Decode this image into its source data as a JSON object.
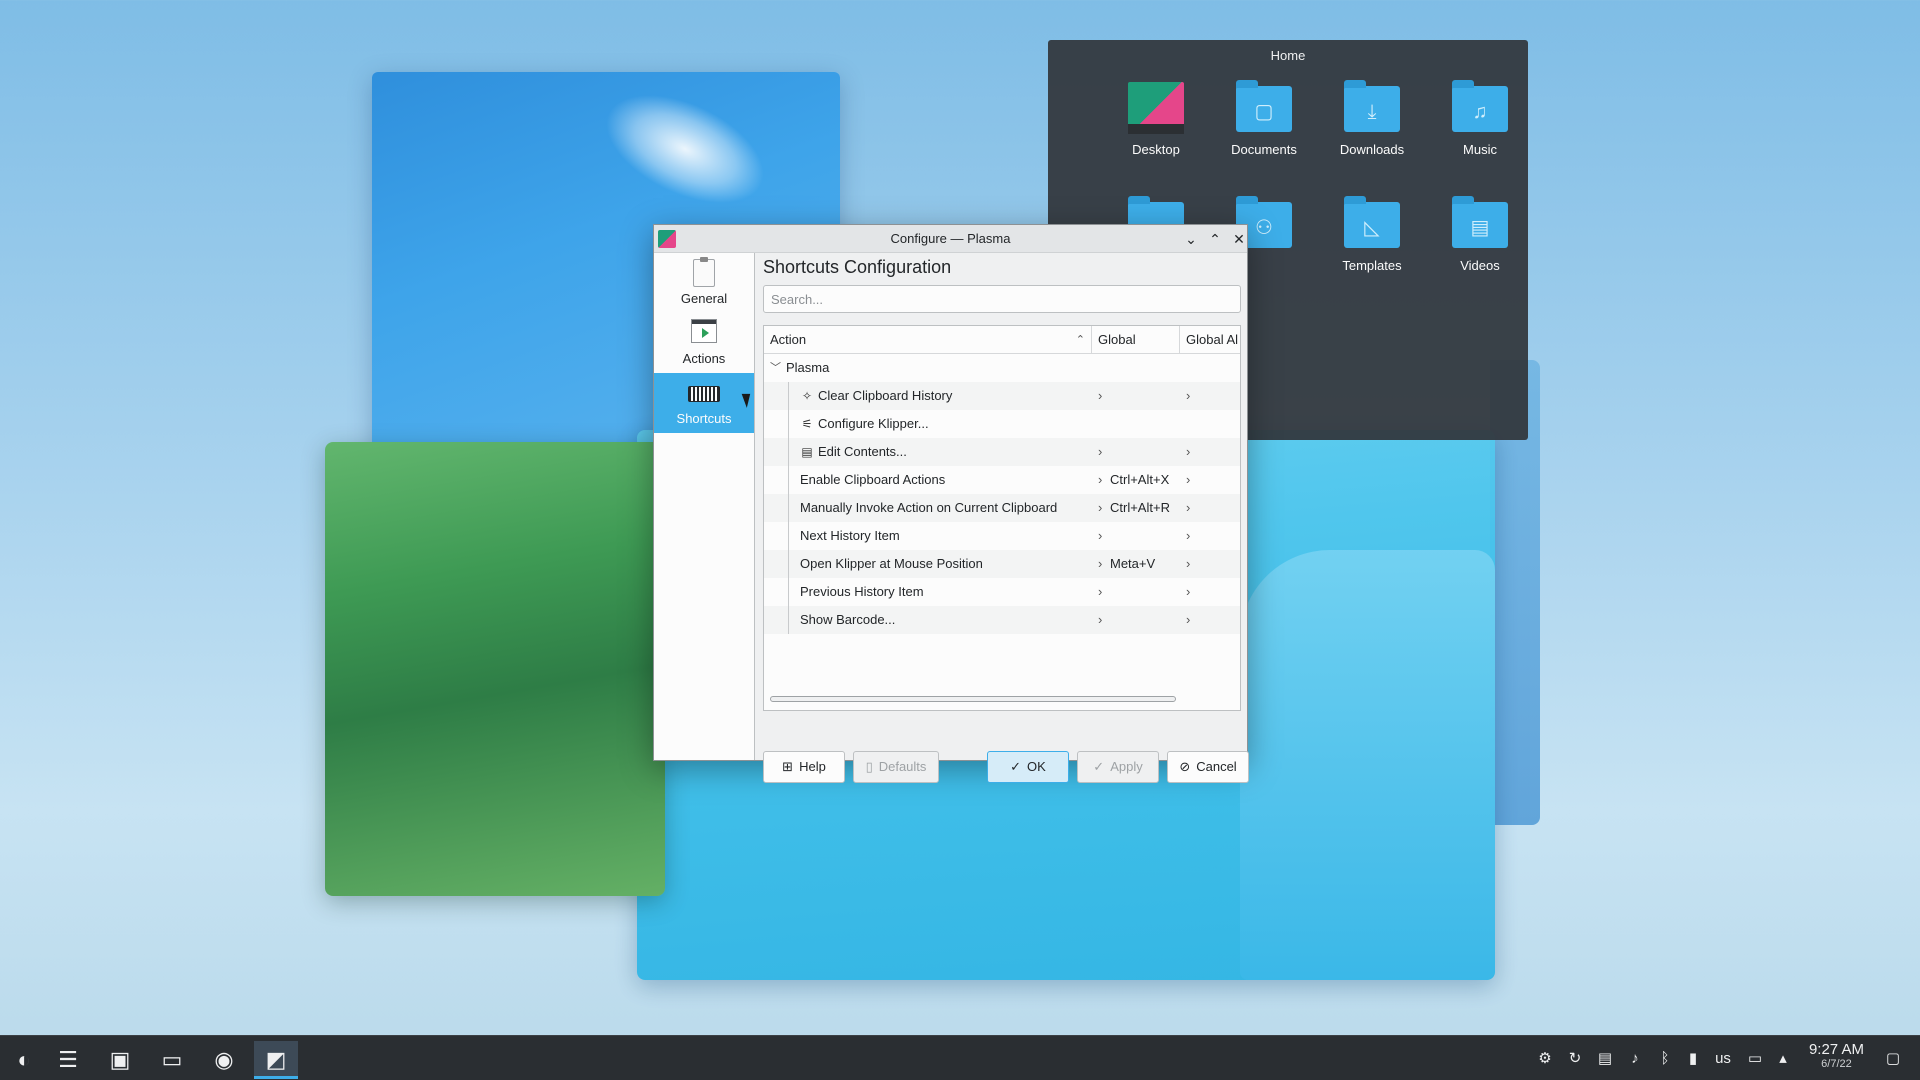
{
  "folder_view": {
    "title": "Home",
    "items": [
      {
        "label": "Desktop",
        "icon": "desktop-icon"
      },
      {
        "label": "Documents",
        "icon": "documents-folder-icon"
      },
      {
        "label": "Downloads",
        "icon": "downloads-folder-icon"
      },
      {
        "label": "Music",
        "icon": "music-folder-icon"
      },
      {
        "label": "",
        "icon": "pictures-folder-icon"
      },
      {
        "label": "",
        "icon": "public-folder-icon"
      },
      {
        "label": "Templates",
        "icon": "templates-folder-icon"
      },
      {
        "label": "Videos",
        "icon": "videos-folder-icon"
      }
    ]
  },
  "dialog": {
    "title": "Configure — Plasma",
    "sidebar": [
      {
        "label": "General",
        "icon": "clipboard-icon"
      },
      {
        "label": "Actions",
        "icon": "actions-icon"
      },
      {
        "label": "Shortcuts",
        "icon": "keyboard-icon",
        "active": true
      }
    ],
    "heading": "Shortcuts Configuration",
    "search_placeholder": "Search...",
    "columns": {
      "action": "Action",
      "global": "Global",
      "global_alt": "Global Al"
    },
    "group": "Plasma",
    "rows": [
      {
        "action": "Clear Clipboard History",
        "global": "",
        "icon": "clear-icon"
      },
      {
        "action": "Configure Klipper...",
        "global": "",
        "icon": "configure-icon",
        "no_chevrons": true
      },
      {
        "action": "Edit Contents...",
        "global": "",
        "icon": "edit-icon"
      },
      {
        "action": "Enable Clipboard Actions",
        "global": "Ctrl+Alt+X"
      },
      {
        "action": "Manually Invoke Action on Current Clipboard",
        "global": "Ctrl+Alt+R"
      },
      {
        "action": "Next History Item",
        "global": ""
      },
      {
        "action": "Open Klipper at Mouse Position",
        "global": "Meta+V"
      },
      {
        "action": "Previous History Item",
        "global": ""
      },
      {
        "action": "Show Barcode...",
        "global": ""
      }
    ],
    "buttons": {
      "help": "Help",
      "defaults": "Defaults",
      "ok": "OK",
      "apply": "Apply",
      "cancel": "Cancel"
    }
  },
  "taskbar": {
    "tray_keyboard_layout": "us",
    "time": "9:27 AM",
    "date": "6/7/22"
  },
  "colors": {
    "accent": "#3daee9",
    "panel": "#2a2e32",
    "dialog_bg": "#eff0f1"
  }
}
